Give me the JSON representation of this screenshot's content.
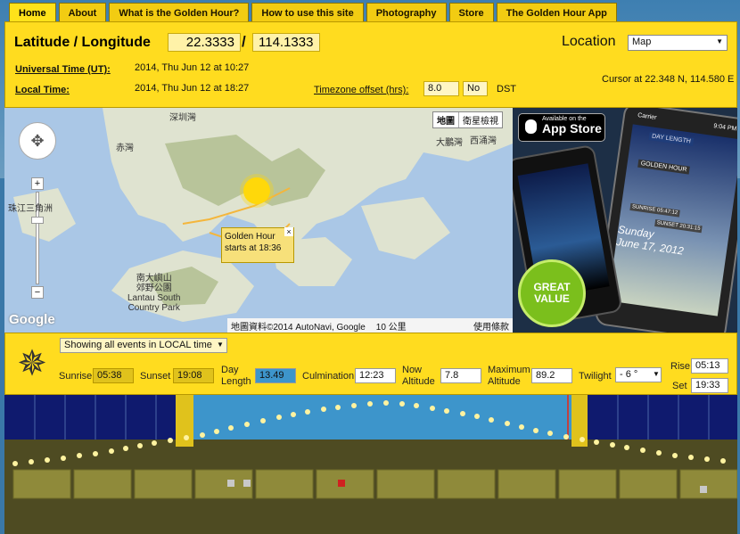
{
  "tabs": [
    "Home",
    "About",
    "What is the Golden Hour?",
    "How to use this site",
    "Photography",
    "Store",
    "The Golden Hour App"
  ],
  "header": {
    "title": "Latitude / Longitude",
    "lat": "22.3333",
    "lon": "114.1333",
    "location_label": "Location",
    "location_select": "Map"
  },
  "times": {
    "ut_label": "Universal Time (UT):",
    "ut_value": "2014, Thu Jun 12 at 10:27",
    "lt_label": "Local Time:",
    "lt_value": "2014, Thu Jun 12 at 18:27",
    "tz_label": "Timezone offset (hrs):",
    "tz_value": "8.0",
    "dst_value": "No",
    "dst_label": "DST",
    "cursor": "Cursor at 22.348 N, 114.580 E"
  },
  "map": {
    "btn_map": "地圖",
    "btn_sat": "衛星檢視",
    "tooltip": "Golden Hour\nstarts at 18:36",
    "label_lantau": "南大嶼山\n郊野公園\nLantau South\nCountry Park",
    "label_shenzhen": "深圳灣",
    "label_pearl": "珠江三角洲",
    "label_chek": "赤灣",
    "label_tai": "大鵬灣",
    "label_sai": "西涌灣",
    "google": "Google",
    "attrib": "地圖資料©2014 AutoNavi, Google",
    "scale": "10 公里",
    "terms": "使用條款"
  },
  "app": {
    "store_top": "Available on the",
    "store_main": "App Store",
    "badge": "GREAT\nVALUE",
    "date": "Sunday\nJune 17, 2012",
    "label_dl": "DAY LENGTH",
    "label_gh": "GOLDEN HOUR",
    "label_sr": "SUNRISE 05:47:12",
    "label_ss": "SUNSET 20:31:15",
    "carrier": "Carrier",
    "clock": "9:04 PM"
  },
  "controls": {
    "events_select": "Showing all events in LOCAL time",
    "sunrise_label": "Sunrise",
    "sunrise": "05:38",
    "sunset_label": "Sunset",
    "sunset": "19:08",
    "daylen_label": "Day\nLength",
    "daylen": "13.49",
    "culm_label": "Culmination",
    "culm": "12:23",
    "nowalt_label": "Now\nAltitude",
    "nowalt": "7.8",
    "maxalt_label": "Maximum\nAltitude",
    "maxalt": "89.2",
    "twilight_label": "Twilight",
    "twilight": "- 6 °",
    "rise_label": "Rise",
    "rise": "05:13",
    "set_label": "Set",
    "set": "19:33"
  },
  "colors": {
    "panel": "#ffdc1f",
    "night": "#0f1a6e",
    "day": "#3d95cb",
    "gold": "#e0c21c",
    "ground": "#4e4b22"
  }
}
